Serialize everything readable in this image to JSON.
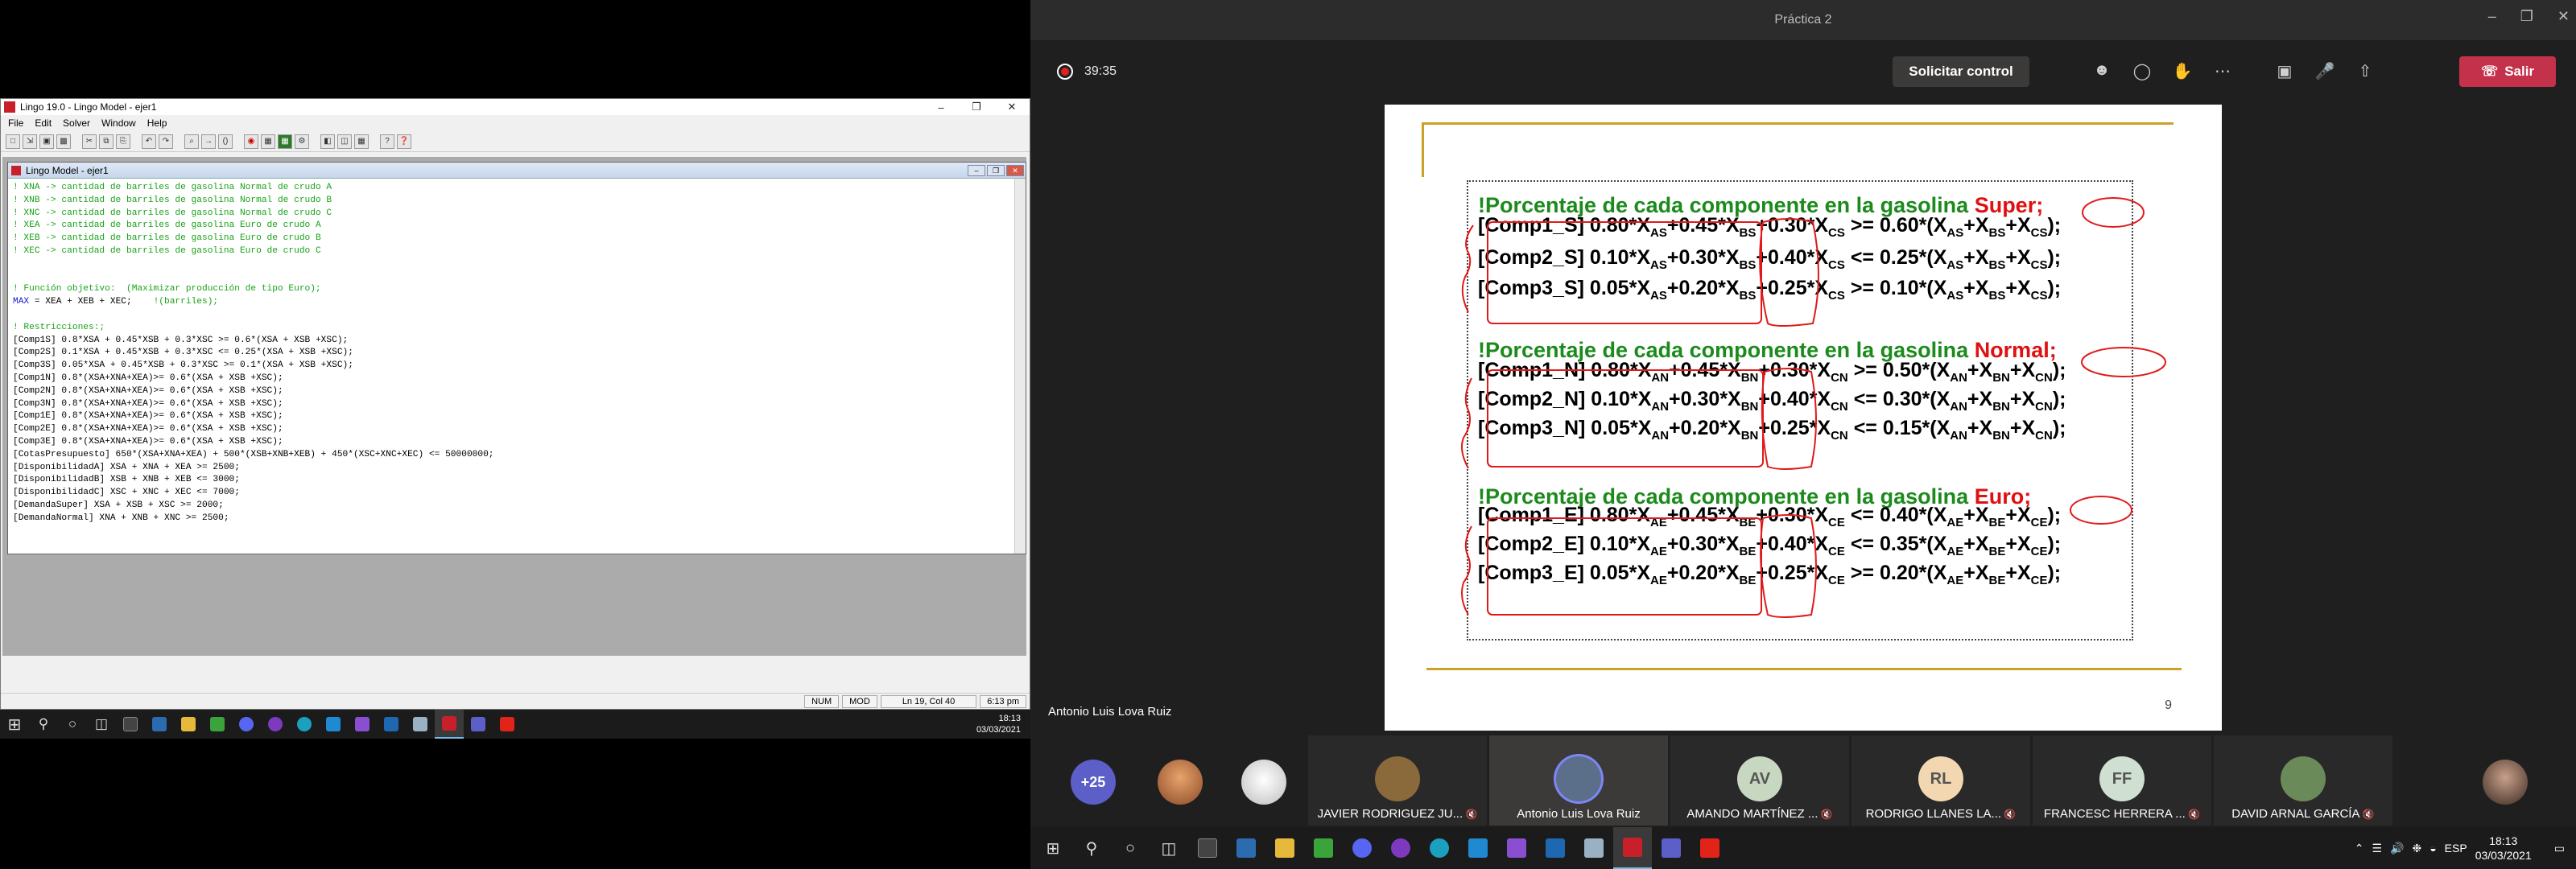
{
  "lingo": {
    "title": "Lingo 19.0 - Lingo Model - ejer1",
    "menu": [
      "File",
      "Edit",
      "Solver",
      "Window",
      "Help"
    ],
    "child_title": "Lingo Model - ejer1",
    "code_lines": [
      {
        "t": "cmt",
        "s": "! XNA -> cantidad de barriles de gasolina Normal de crudo A"
      },
      {
        "t": "cmt",
        "s": "! XNB -> cantidad de barriles de gasolina Normal de crudo B"
      },
      {
        "t": "cmt",
        "s": "! XNC -> cantidad de barriles de gasolina Normal de crudo C"
      },
      {
        "t": "cmt",
        "s": "! XEA -> cantidad de barriles de gasolina Euro de crudo A"
      },
      {
        "t": "cmt",
        "s": "! XEB -> cantidad de barriles de gasolina Euro de crudo B"
      },
      {
        "t": "cmt",
        "s": "! XEC -> cantidad de barriles de gasolina Euro de crudo C"
      },
      {
        "t": "txt",
        "s": ""
      },
      {
        "t": "txt",
        "s": ""
      },
      {
        "t": "cmt",
        "s": "! Función objetivo:  (Maximizar producción de tipo Euro);"
      },
      {
        "t": "max",
        "s": " = XEA + XEB + XEC;",
        "k": "MAX",
        "c": "    !(barriles);"
      },
      {
        "t": "txt",
        "s": ""
      },
      {
        "t": "cmt",
        "s": "! Restricciones:;"
      },
      {
        "t": "txt",
        "s": "[Comp1S] 0.8*XSA + 0.45*XSB + 0.3*XSC >= 0.6*(XSA + XSB +XSC);"
      },
      {
        "t": "txt",
        "s": "[Comp2S] 0.1*XSA + 0.45*XSB + 0.3*XSC <= 0.25*(XSA + XSB +XSC);"
      },
      {
        "t": "txt",
        "s": "[Comp3S] 0.05*XSA + 0.45*XSB + 0.3*XSC >= 0.1*(XSA + XSB +XSC);"
      },
      {
        "t": "txt",
        "s": "[Comp1N] 0.8*(XSA+XNA+XEA)>= 0.6*(XSA + XSB +XSC);"
      },
      {
        "t": "txt",
        "s": "[Comp2N] 0.8*(XSA+XNA+XEA)>= 0.6*(XSA + XSB +XSC);"
      },
      {
        "t": "txt",
        "s": "[Comp3N] 0.8*(XSA+XNA+XEA)>= 0.6*(XSA + XSB +XSC);"
      },
      {
        "t": "txt",
        "s": "[Comp1E] 0.8*(XSA+XNA+XEA)>= 0.6*(XSA + XSB +XSC);"
      },
      {
        "t": "txt",
        "s": "[Comp2E] 0.8*(XSA+XNA+XEA)>= 0.6*(XSA + XSB +XSC);"
      },
      {
        "t": "txt",
        "s": "[Comp3E] 0.8*(XSA+XNA+XEA)>= 0.6*(XSA + XSB +XSC);"
      },
      {
        "t": "txt",
        "s": "[CotasPresupuesto] 650*(XSA+XNA+XEA) + 500*(XSB+XNB+XEB) + 450*(XSC+XNC+XEC) <= 50000000;"
      },
      {
        "t": "txt",
        "s": "[DisponibilidadA] XSA + XNA + XEA >= 2500;"
      },
      {
        "t": "txt",
        "s": "[DisponibilidadB] XSB + XNB + XEB <= 3000;"
      },
      {
        "t": "txt",
        "s": "[DisponibilidadC] XSC + XNC + XEC <= 7000;"
      },
      {
        "t": "txt",
        "s": "[DemandaSuper] XSA + XSB + XSC >= 2000;"
      },
      {
        "t": "txt",
        "s": "[DemandaNormal] XNA + XNB + XNC >= 2500;"
      }
    ],
    "status": [
      "NUM",
      "MOD",
      "Ln 19, Col 40",
      "6:13 pm"
    ],
    "taskbar_time": "18:13",
    "taskbar_date": "03/03/2021"
  },
  "teams": {
    "window_title": "Práctica 2",
    "timer": "39:35",
    "request_control": "Solicitar control",
    "leave": "Salir",
    "speaker": "Antonio Luis Lova Ruiz",
    "slide": {
      "page": "9",
      "sections": [
        {
          "title": "!Porcentaje de cada componente en la gasolina ",
          "highlight": "Super",
          "end": ";",
          "sub": "S",
          "rows": [
            {
              "label": "[Comp1_S]",
              "c": [
                "0.80",
                "+0.45",
                "+0.30"
              ],
              "op": ">=",
              "rhs": "0.60"
            },
            {
              "label": "[Comp2_S]",
              "c": [
                "0.10",
                "+0.30",
                "+0.40"
              ],
              "op": "<=",
              "rhs": "0.25"
            },
            {
              "label": "[Comp3_S]",
              "c": [
                "0.05",
                "+0.20",
                "+0.25"
              ],
              "op": ">=",
              "rhs": "0.10"
            }
          ]
        },
        {
          "title": "!Porcentaje de cada componente en la gasolina ",
          "highlight": "Normal",
          "end": ";",
          "sub": "N",
          "rows": [
            {
              "label": "[Comp1_N]",
              "c": [
                "0.80",
                "+0.45",
                "+0.30"
              ],
              "op": ">=",
              "rhs": "0.50"
            },
            {
              "label": "[Comp2_N]",
              "c": [
                "0.10",
                "+0.30",
                "+0.40"
              ],
              "op": "<=",
              "rhs": "0.30"
            },
            {
              "label": "[Comp3_N]",
              "c": [
                "0.05",
                "+0.20",
                "+0.25"
              ],
              "op": "<=",
              "rhs": "0.15"
            }
          ]
        },
        {
          "title": "!Porcentaje de cada componente en la gasolina ",
          "highlight": "Euro",
          "end": ";",
          "sub": "E",
          "rows": [
            {
              "label": "[Comp1_E]",
              "c": [
                "0.80",
                "+0.45",
                "+0.30"
              ],
              "op": "<=",
              "rhs": "0.40"
            },
            {
              "label": "[Comp2_E]",
              "c": [
                "0.10",
                "+0.30",
                "+0.40"
              ],
              "op": "<=",
              "rhs": "0.35"
            },
            {
              "label": "[Comp3_E]",
              "c": [
                "0.05",
                "+0.20",
                "+0.25"
              ],
              "op": ">=",
              "rhs": "0.20"
            }
          ]
        }
      ]
    },
    "participants": {
      "more": "+25",
      "tiles": [
        {
          "name": "JAVIER RODRIGUEZ JU...",
          "initials": "",
          "color": "#8a6a3a"
        },
        {
          "name": "Antonio Luis Lova Ruiz",
          "initials": "",
          "color": "#5b6f8a"
        },
        {
          "name": "AMANDO MARTÍNEZ ...",
          "initials": "AV",
          "color": "#c8d7c0"
        },
        {
          "name": "RODRIGO LLANES LA...",
          "initials": "RL",
          "color": "#f2d7b0"
        },
        {
          "name": "FRANCESC HERRERA ...",
          "initials": "FF",
          "color": "#cfe0d2"
        },
        {
          "name": "DAVID ARNAL GARCÍA",
          "initials": "",
          "color": "#6b8a5a"
        }
      ]
    },
    "taskbar": {
      "lang": "ESP",
      "time": "18:13",
      "date": "03/03/2021"
    }
  }
}
